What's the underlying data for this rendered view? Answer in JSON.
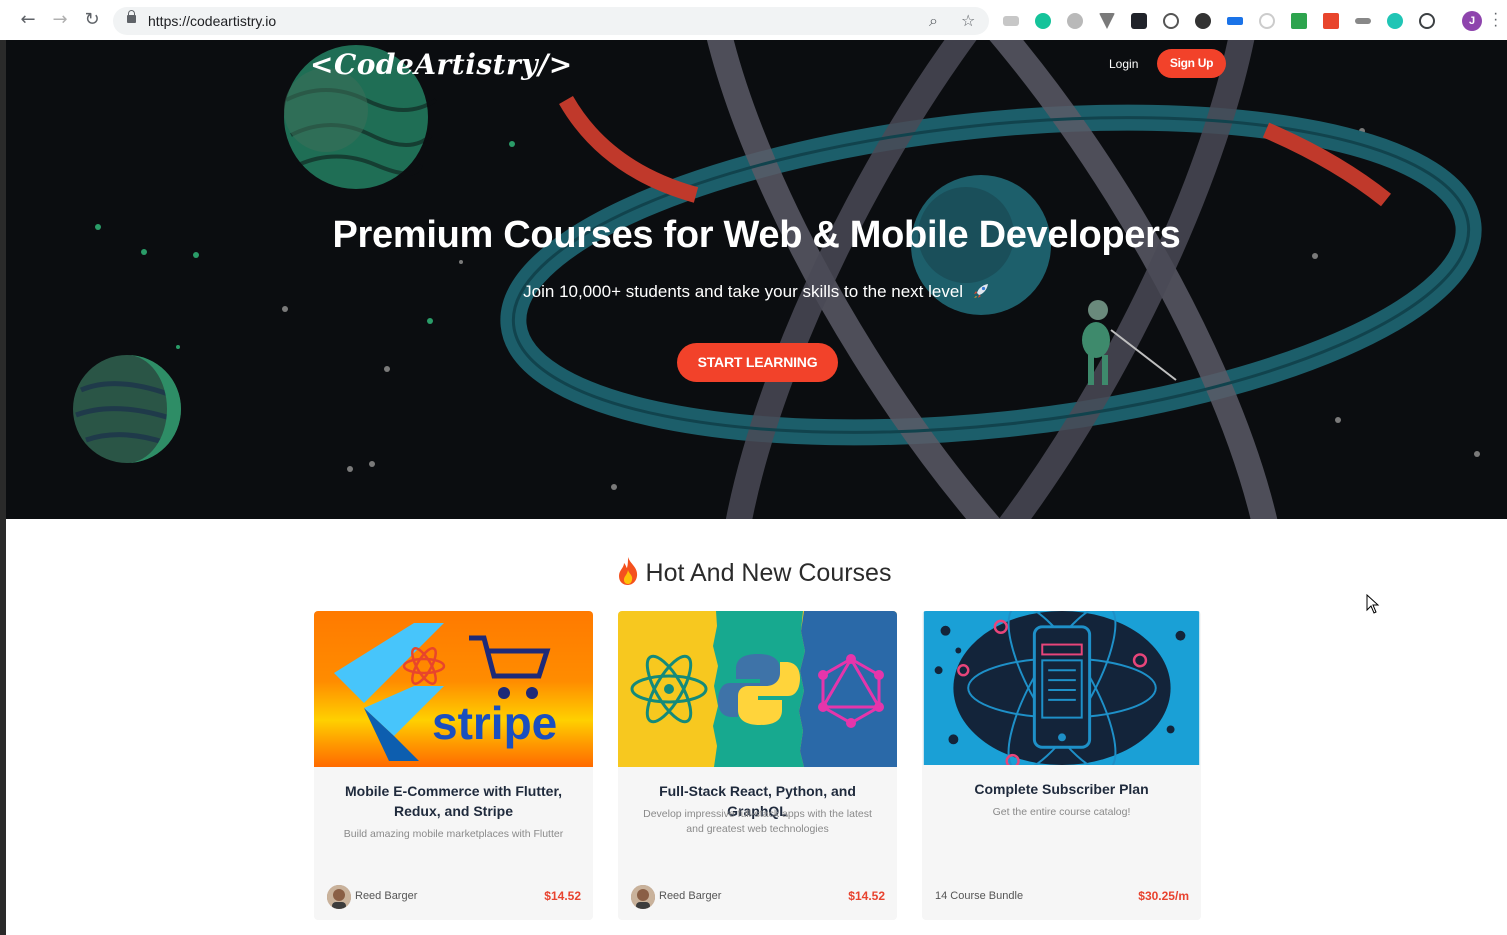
{
  "browser": {
    "url": "https://codeartistry.io",
    "profile_initial": "J"
  },
  "header": {
    "logo": "<CodeArtistry/>",
    "login": "Login",
    "signup": "Sign Up"
  },
  "hero": {
    "title": "Premium Courses for Web & Mobile Developers",
    "subtitle": "Join 10,000+ students and take your skills to the next level",
    "cta": "START LEARNING"
  },
  "courses_section": {
    "title": "Hot And New Courses",
    "cards": [
      {
        "title": "Mobile E-Commerce with Flutter, Redux, and Stripe",
        "description": "Build amazing mobile marketplaces with Flutter",
        "author": "Reed Barger",
        "price": "$14.52",
        "thumb_text": "stripe"
      },
      {
        "title": "Full-Stack React, Python, and GraphQL",
        "description": "Develop impressive full-stack apps with the latest and greatest web technologies",
        "author": "Reed Barger",
        "price": "$14.52"
      },
      {
        "title": "Complete Subscriber Plan",
        "description": "Get the entire course catalog!",
        "bundle": "14 Course Bundle",
        "price": "$30.25/m"
      }
    ]
  },
  "colors": {
    "accent": "#f2422a",
    "hero_bg": "#0b0d10",
    "price": "#e8432f"
  }
}
